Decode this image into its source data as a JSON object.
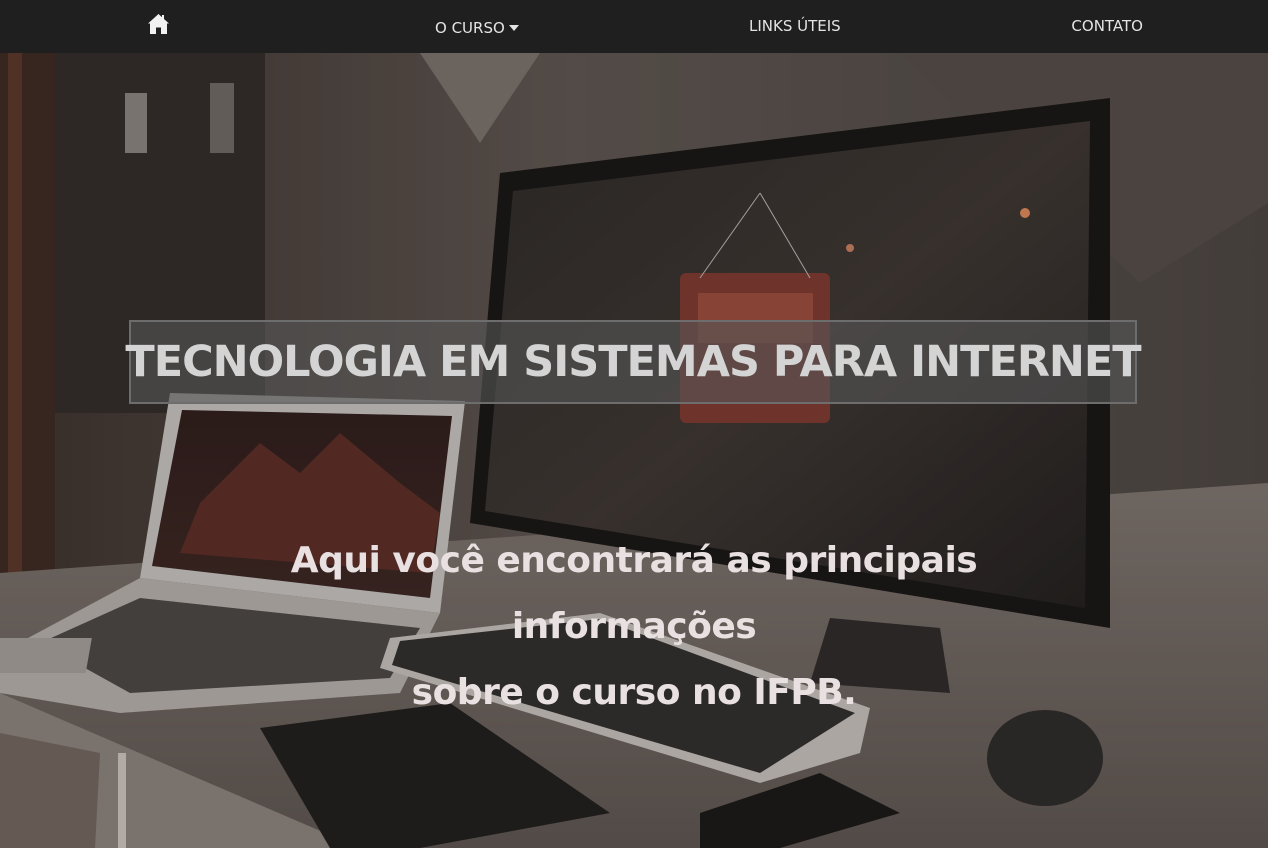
{
  "nav": {
    "home_icon": "home-icon",
    "items": [
      {
        "label": "O CURSO",
        "icon": "caret-down-icon"
      },
      {
        "label": "LINKS ÚTEIS"
      },
      {
        "label": "CONTATO"
      }
    ]
  },
  "hero": {
    "title": "TECNOLOGIA EM SISTEMAS PARA INTERNET",
    "subtitle_line1": "Aqui você encontrará as principais informações",
    "subtitle_line2": "sobre o curso no IFPB."
  },
  "colors": {
    "navbar_bg": "#1f1f1f",
    "nav_text": "#e4e4e4",
    "title_text": "#d4d4d4",
    "subtitle_text": "#e9e1e1"
  }
}
